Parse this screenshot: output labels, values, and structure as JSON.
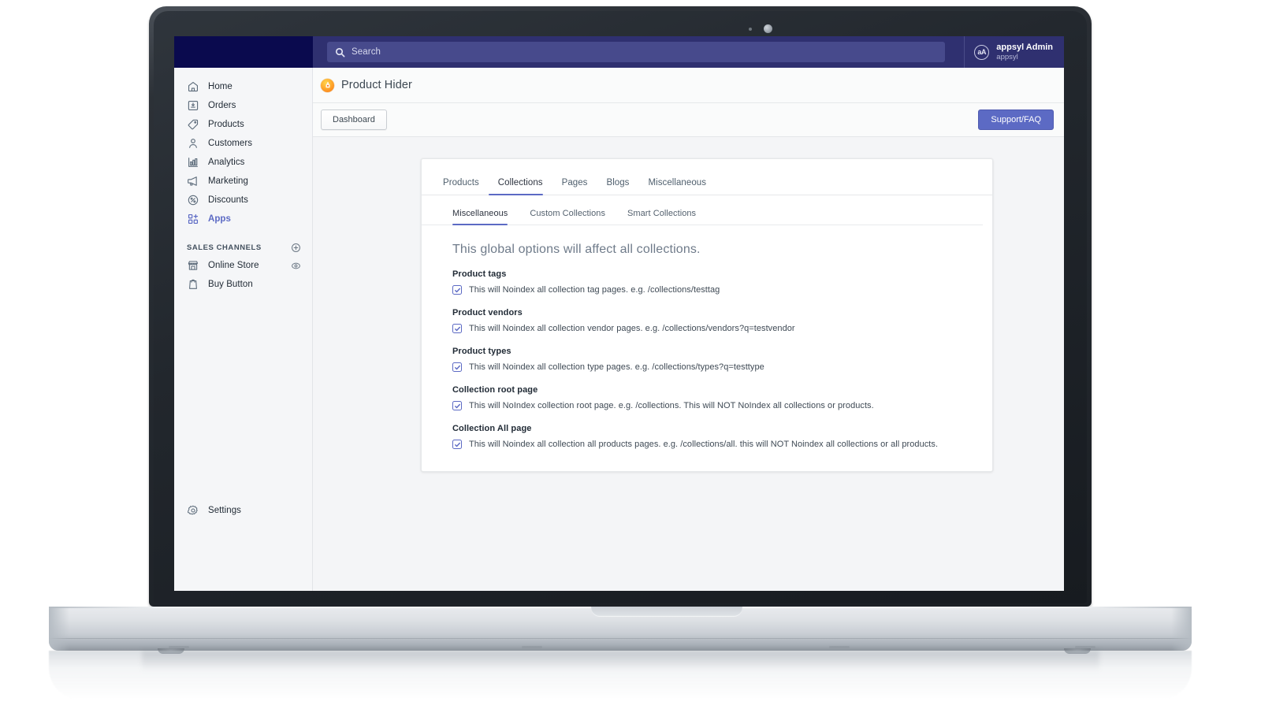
{
  "topbar": {
    "search": {
      "placeholder": "Search",
      "value": "",
      "icon": "search-icon"
    },
    "user": {
      "initials": "aA",
      "name": "appsyl Admin",
      "store": "appsyl"
    }
  },
  "sidebar": {
    "items": [
      {
        "label": "Home",
        "icon": "home-icon",
        "active": false
      },
      {
        "label": "Orders",
        "icon": "orders-icon",
        "active": false
      },
      {
        "label": "Products",
        "icon": "products-tag-icon",
        "active": false
      },
      {
        "label": "Customers",
        "icon": "customers-icon",
        "active": false
      },
      {
        "label": "Analytics",
        "icon": "analytics-bar-icon",
        "active": false
      },
      {
        "label": "Marketing",
        "icon": "marketing-megaphone-icon",
        "active": false
      },
      {
        "label": "Discounts",
        "icon": "discounts-percent-icon",
        "active": false
      },
      {
        "label": "Apps",
        "icon": "apps-grid-plus-icon",
        "active": true
      }
    ],
    "section": {
      "title": "Sales channels",
      "action_icon": "plus-circle-icon"
    },
    "channels": [
      {
        "label": "Online Store",
        "icon": "storefront-icon",
        "trailing_icon": "eye-icon"
      },
      {
        "label": "Buy Button",
        "icon": "shopify-bag-icon",
        "trailing_icon": ""
      }
    ],
    "settings": {
      "label": "Settings",
      "icon": "gear-icon"
    }
  },
  "app": {
    "title": "Product Hider",
    "icon": "product-hider-app-icon"
  },
  "action_bar": {
    "dashboard_label": "Dashboard",
    "support_label": "Support/FAQ"
  },
  "card": {
    "primary_tabs": [
      {
        "label": "Products",
        "active": false
      },
      {
        "label": "Collections",
        "active": true
      },
      {
        "label": "Pages",
        "active": false
      },
      {
        "label": "Blogs",
        "active": false
      },
      {
        "label": "Miscellaneous",
        "active": false
      }
    ],
    "secondary_tabs": [
      {
        "label": "Miscellaneous",
        "active": true
      },
      {
        "label": "Custom Collections",
        "active": false
      },
      {
        "label": "Smart Collections",
        "active": false
      }
    ],
    "global_note": "This global options will affect all collections.",
    "options": [
      {
        "title": "Product tags",
        "checked": true,
        "text": "This will Noindex all collection tag pages. e.g. /collections/testtag"
      },
      {
        "title": "Product vendors",
        "checked": true,
        "text": "This will Noindex all collection vendor pages. e.g. /collections/vendors?q=testvendor"
      },
      {
        "title": "Product types",
        "checked": true,
        "text": "This will Noindex all collection type pages. e.g. /collections/types?q=testtype"
      },
      {
        "title": "Collection root page",
        "checked": true,
        "text": "This will NoIndex collection root page. e.g. /collections. This will NOT NoIndex all collections or products."
      },
      {
        "title": "Collection All page",
        "checked": true,
        "text": "This will Noindex all collection all products pages. e.g. /collections/all. this will NOT Noindex all collections or all products."
      }
    ]
  },
  "colors": {
    "accent": "#5c6ac4",
    "topbar_dark": "#0a0a4e",
    "topbar": "#2f3070",
    "page_bg": "#f4f5f7",
    "app_icon": "#f97316"
  }
}
